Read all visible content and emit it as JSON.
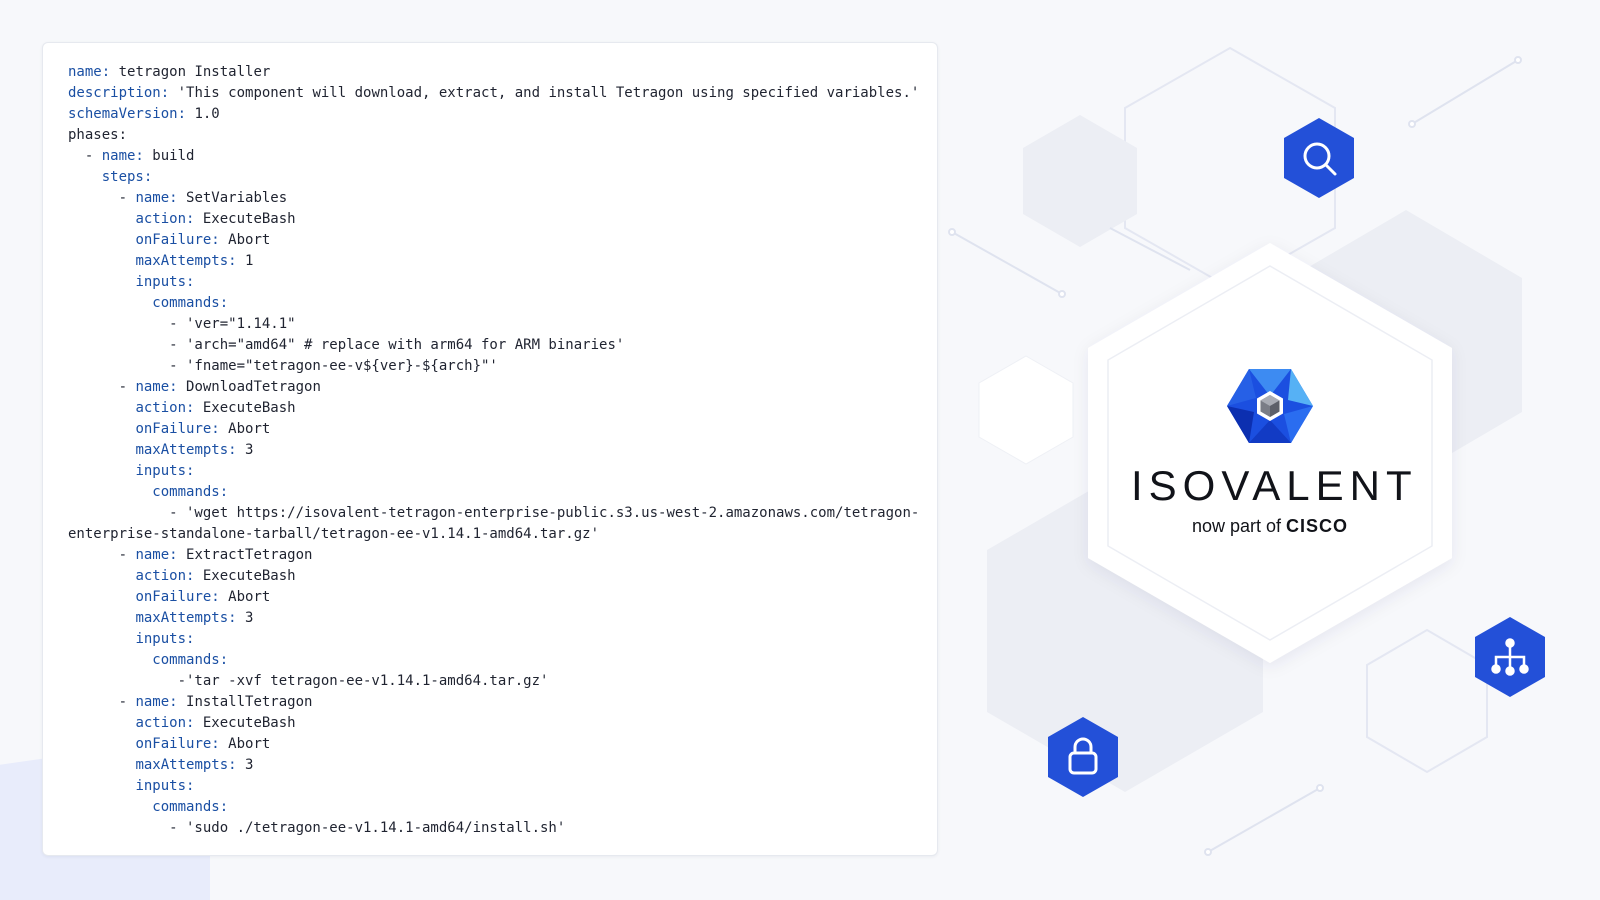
{
  "code_card": {
    "lines": [
      {
        "indent": "",
        "key": "name:",
        "value": " tetragon Installer"
      },
      {
        "indent": "",
        "key": "description:",
        "value": " 'This component will download, extract, and install Tetragon using specified variables.'"
      },
      {
        "indent": "",
        "key": "schemaVersion:",
        "value": " 1.0"
      },
      {
        "indent": "",
        "key": "",
        "value": "phases:"
      },
      {
        "indent": "  - ",
        "key": "name:",
        "value": " build"
      },
      {
        "indent": "    ",
        "key": "steps:",
        "value": ""
      },
      {
        "indent": "      - ",
        "key": "name:",
        "value": " SetVariables"
      },
      {
        "indent": "        ",
        "key": "action:",
        "value": " ExecuteBash"
      },
      {
        "indent": "        ",
        "key": "onFailure:",
        "value": " Abort"
      },
      {
        "indent": "        ",
        "key": "maxAttempts:",
        "value": " 1"
      },
      {
        "indent": "        ",
        "key": "inputs:",
        "value": ""
      },
      {
        "indent": "          ",
        "key": "commands:",
        "value": ""
      },
      {
        "indent": "",
        "key": "",
        "value": "            - 'ver=\"1.14.1\""
      },
      {
        "indent": "",
        "key": "",
        "value": "            - 'arch=\"amd64\" # replace with arm64 for ARM binaries'"
      },
      {
        "indent": "",
        "key": "",
        "value": "            - 'fname=\"tetragon-ee-v${ver}-${arch}\"'"
      },
      {
        "indent": "      - ",
        "key": "name:",
        "value": " DownloadTetragon"
      },
      {
        "indent": "        ",
        "key": "action:",
        "value": " ExecuteBash"
      },
      {
        "indent": "        ",
        "key": "onFailure:",
        "value": " Abort"
      },
      {
        "indent": "        ",
        "key": "maxAttempts:",
        "value": " 3"
      },
      {
        "indent": "        ",
        "key": "inputs:",
        "value": ""
      },
      {
        "indent": "          ",
        "key": "commands:",
        "value": ""
      },
      {
        "indent": "",
        "key": "",
        "value": "            - 'wget https://isovalent-tetragon-enterprise-public.s3.us-west-2.amazonaws.com/tetragon-"
      },
      {
        "indent": "",
        "key": "",
        "value": "enterprise-standalone-tarball/tetragon-ee-v1.14.1-amd64.tar.gz'"
      },
      {
        "indent": "      - ",
        "key": "name:",
        "value": " ExtractTetragon"
      },
      {
        "indent": "        ",
        "key": "action:",
        "value": " ExecuteBash"
      },
      {
        "indent": "        ",
        "key": "onFailure:",
        "value": " Abort"
      },
      {
        "indent": "        ",
        "key": "maxAttempts:",
        "value": " 3"
      },
      {
        "indent": "        ",
        "key": "inputs:",
        "value": ""
      },
      {
        "indent": "          ",
        "key": "commands:",
        "value": ""
      },
      {
        "indent": "",
        "key": "",
        "value": "             -'tar -xvf tetragon-ee-v1.14.1-amd64.tar.gz'"
      },
      {
        "indent": "      - ",
        "key": "name:",
        "value": " InstallTetragon"
      },
      {
        "indent": "        ",
        "key": "action:",
        "value": " ExecuteBash"
      },
      {
        "indent": "        ",
        "key": "onFailure:",
        "value": " Abort"
      },
      {
        "indent": "        ",
        "key": "maxAttempts:",
        "value": " 3"
      },
      {
        "indent": "        ",
        "key": "inputs:",
        "value": ""
      },
      {
        "indent": "          ",
        "key": "commands:",
        "value": ""
      },
      {
        "indent": "",
        "key": "",
        "value": "            - 'sudo ./tetragon-ee-v1.14.1-amd64/install.sh'"
      }
    ]
  },
  "logo": {
    "title": "ISOVALENT",
    "subtitle_prefix": "now part of ",
    "subtitle_brand": "CISCO"
  },
  "icons": {
    "search": "search-icon",
    "network": "network-icon",
    "lock": "lock-icon"
  },
  "colors": {
    "accent_blue": "#2350d8",
    "yaml_key": "#1a4fa3",
    "text": "#1f2330"
  }
}
